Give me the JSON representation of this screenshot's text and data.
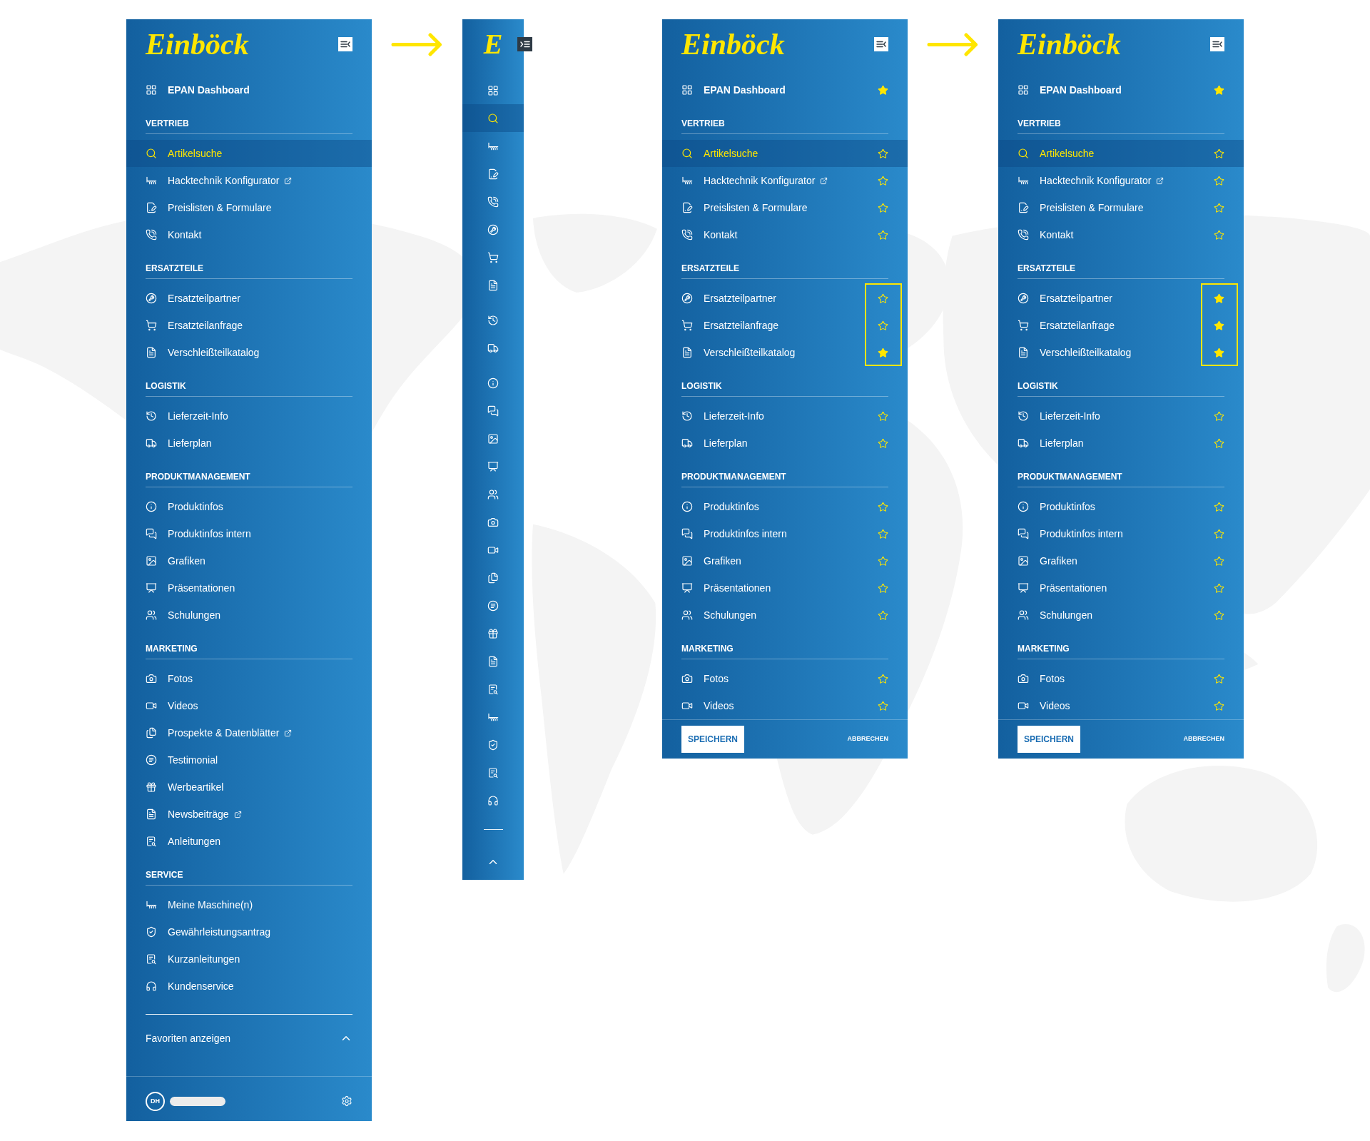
{
  "flows": [
    {
      "panels": [
        {
          "kind": "expanded",
          "logo": "Einböck",
          "sections": [
            {
              "items": [
                {
                  "label": "EPAN Dashboard",
                  "kind": "dashboard",
                  "selected": false,
                  "external": false
                }
              ]
            },
            {
              "title": "VERTRIEB",
              "items": [
                {
                  "label": "Artikelsuche",
                  "kind": "search",
                  "selected": true,
                  "external": false
                },
                {
                  "label": "Hacktechnik Konfigurator",
                  "kind": "rake",
                  "selected": false,
                  "external": true
                },
                {
                  "label": "Preislisten & Formulare",
                  "kind": "form",
                  "selected": false,
                  "external": false
                },
                {
                  "label": "Kontakt",
                  "kind": "phone",
                  "selected": false,
                  "external": false
                }
              ]
            },
            {
              "title": "ERSATZTEILE",
              "items": [
                {
                  "label": "Ersatzteilpartner",
                  "kind": "wrench",
                  "selected": false,
                  "external": false
                },
                {
                  "label": "Ersatzteilanfrage",
                  "kind": "cart",
                  "selected": false,
                  "external": false
                },
                {
                  "label": "Verschleißteilkatalog",
                  "kind": "catalog",
                  "selected": false,
                  "external": false
                }
              ]
            },
            {
              "title": "LOGISTIK",
              "items": [
                {
                  "label": "Lieferzeit-Info",
                  "kind": "clock",
                  "selected": false,
                  "external": false
                },
                {
                  "label": "Lieferplan",
                  "kind": "truck",
                  "selected": false,
                  "external": false
                }
              ]
            },
            {
              "title": "PRODUKTMANAGEMENT",
              "items": [
                {
                  "label": "Produktinfos",
                  "kind": "info",
                  "selected": false,
                  "external": false
                },
                {
                  "label": "Produktinfos intern",
                  "kind": "chat",
                  "selected": false,
                  "external": false
                },
                {
                  "label": "Grafiken",
                  "kind": "image",
                  "selected": false,
                  "external": false
                },
                {
                  "label": "Präsentationen",
                  "kind": "presentation",
                  "selected": false,
                  "external": false
                },
                {
                  "label": "Schulungen",
                  "kind": "training",
                  "selected": false,
                  "external": false
                }
              ]
            },
            {
              "title": "MARKETING",
              "items": [
                {
                  "label": "Fotos",
                  "kind": "camera",
                  "selected": false,
                  "external": false
                },
                {
                  "label": "Videos",
                  "kind": "video",
                  "selected": false,
                  "external": false
                },
                {
                  "label": "Prospekte & Datenblätter",
                  "kind": "brochure",
                  "selected": false,
                  "external": true
                },
                {
                  "label": "Testimonial",
                  "kind": "testimonial",
                  "selected": false,
                  "external": false
                },
                {
                  "label": "Werbeartikel",
                  "kind": "gift",
                  "selected": false,
                  "external": false
                },
                {
                  "label": "Newsbeiträge",
                  "kind": "news",
                  "selected": false,
                  "external": true
                },
                {
                  "label": "Anleitungen",
                  "kind": "manual",
                  "selected": false,
                  "external": false
                }
              ]
            },
            {
              "title": "SERVICE",
              "items": [
                {
                  "label": "Meine Maschine(n)",
                  "kind": "rake",
                  "selected": false,
                  "external": false
                },
                {
                  "label": "Gewährleistungsantrag",
                  "kind": "shield",
                  "selected": false,
                  "external": false
                },
                {
                  "label": "Kurzanleitungen",
                  "kind": "manual",
                  "selected": false,
                  "external": false
                },
                {
                  "label": "Kundenservice",
                  "kind": "headset",
                  "selected": false,
                  "external": false
                }
              ]
            }
          ],
          "favorites_toggle": {
            "label": "Favoriten anzeigen",
            "expanded": true
          },
          "user": {
            "initials": "DH"
          }
        },
        {
          "kind": "collapsed",
          "logo": "E",
          "groups": [
            {
              "items": [
                {
                  "kind": "dashboard",
                  "selected": false
                },
                {
                  "kind": "search",
                  "selected": true
                },
                {
                  "kind": "rake",
                  "selected": false
                },
                {
                  "kind": "form",
                  "selected": false
                },
                {
                  "kind": "phone",
                  "selected": false
                },
                {
                  "kind": "wrench",
                  "selected": false
                },
                {
                  "kind": "cart",
                  "selected": false
                },
                {
                  "kind": "catalog",
                  "selected": false
                }
              ]
            },
            {
              "items": [
                {
                  "kind": "clock",
                  "selected": false
                },
                {
                  "kind": "truck",
                  "selected": false
                }
              ]
            },
            {
              "items": [
                {
                  "kind": "info",
                  "selected": false
                },
                {
                  "kind": "chat",
                  "selected": false
                },
                {
                  "kind": "image",
                  "selected": false
                },
                {
                  "kind": "presentation",
                  "selected": false
                },
                {
                  "kind": "training",
                  "selected": false
                },
                {
                  "kind": "camera",
                  "selected": false
                },
                {
                  "kind": "video",
                  "selected": false
                },
                {
                  "kind": "brochure",
                  "selected": false
                },
                {
                  "kind": "testimonial",
                  "selected": false
                },
                {
                  "kind": "gift",
                  "selected": false
                },
                {
                  "kind": "news",
                  "selected": false
                },
                {
                  "kind": "manual",
                  "selected": false
                },
                {
                  "kind": "rake",
                  "selected": false
                },
                {
                  "kind": "shield",
                  "selected": false
                },
                {
                  "kind": "manual",
                  "selected": false
                },
                {
                  "kind": "headset",
                  "selected": false
                }
              ]
            }
          ],
          "favorites_toggle": {
            "expanded": true
          }
        }
      ]
    },
    {
      "panels": [
        {
          "kind": "editing",
          "logo": "Einböck",
          "sections": [
            {
              "outlined": false,
              "items": [
                {
                  "label": "EPAN Dashboard",
                  "kind": "dashboard",
                  "selected": false,
                  "external": false,
                  "favorite": true
                }
              ]
            },
            {
              "title": "VERTRIEB",
              "outlined": false,
              "items": [
                {
                  "label": "Artikelsuche",
                  "kind": "search",
                  "selected": true,
                  "external": false,
                  "favorite": false
                },
                {
                  "label": "Hacktechnik Konfigurator",
                  "kind": "rake",
                  "selected": false,
                  "external": true,
                  "favorite": false
                },
                {
                  "label": "Preislisten & Formulare",
                  "kind": "form",
                  "selected": false,
                  "external": false,
                  "favorite": false
                },
                {
                  "label": "Kontakt",
                  "kind": "phone",
                  "selected": false,
                  "external": false,
                  "favorite": false
                }
              ]
            },
            {
              "title": "ERSATZTEILE",
              "outlined": true,
              "items": [
                {
                  "label": "Ersatzteilpartner",
                  "kind": "wrench",
                  "selected": false,
                  "external": false,
                  "favorite": false
                },
                {
                  "label": "Ersatzteilanfrage",
                  "kind": "cart",
                  "selected": false,
                  "external": false,
                  "favorite": false
                },
                {
                  "label": "Verschleißteilkatalog",
                  "kind": "catalog",
                  "selected": false,
                  "external": false,
                  "favorite": true
                }
              ]
            },
            {
              "title": "LOGISTIK",
              "outlined": false,
              "items": [
                {
                  "label": "Lieferzeit-Info",
                  "kind": "clock",
                  "selected": false,
                  "external": false,
                  "favorite": false
                },
                {
                  "label": "Lieferplan",
                  "kind": "truck",
                  "selected": false,
                  "external": false,
                  "favorite": false
                }
              ]
            },
            {
              "title": "PRODUKTMANAGEMENT",
              "outlined": false,
              "items": [
                {
                  "label": "Produktinfos",
                  "kind": "info",
                  "selected": false,
                  "external": false,
                  "favorite": false
                },
                {
                  "label": "Produktinfos intern",
                  "kind": "chat",
                  "selected": false,
                  "external": false,
                  "favorite": false
                },
                {
                  "label": "Grafiken",
                  "kind": "image",
                  "selected": false,
                  "external": false,
                  "favorite": false
                },
                {
                  "label": "Präsentationen",
                  "kind": "presentation",
                  "selected": false,
                  "external": false,
                  "favorite": false
                },
                {
                  "label": "Schulungen",
                  "kind": "training",
                  "selected": false,
                  "external": false,
                  "favorite": false
                }
              ]
            },
            {
              "title": "MARKETING",
              "outlined": false,
              "items": [
                {
                  "label": "Fotos",
                  "kind": "camera",
                  "selected": false,
                  "external": false,
                  "favorite": false
                },
                {
                  "label": "Videos",
                  "kind": "video",
                  "selected": false,
                  "external": false,
                  "favorite": false
                }
              ]
            }
          ],
          "buttons": [
            {
              "label": "SPEICHERN",
              "kind": "save"
            },
            {
              "label": "ABBRECHEN",
              "kind": "cancel"
            }
          ]
        },
        {
          "kind": "editing",
          "logo": "Einböck",
          "sections": [
            {
              "outlined": false,
              "items": [
                {
                  "label": "EPAN Dashboard",
                  "kind": "dashboard",
                  "selected": false,
                  "external": false,
                  "favorite": true
                }
              ]
            },
            {
              "title": "VERTRIEB",
              "outlined": false,
              "items": [
                {
                  "label": "Artikelsuche",
                  "kind": "search",
                  "selected": true,
                  "external": false,
                  "favorite": false
                },
                {
                  "label": "Hacktechnik Konfigurator",
                  "kind": "rake",
                  "selected": false,
                  "external": true,
                  "favorite": false
                },
                {
                  "label": "Preislisten & Formulare",
                  "kind": "form",
                  "selected": false,
                  "external": false,
                  "favorite": false
                },
                {
                  "label": "Kontakt",
                  "kind": "phone",
                  "selected": false,
                  "external": false,
                  "favorite": false
                }
              ]
            },
            {
              "title": "ERSATZTEILE",
              "outlined": true,
              "items": [
                {
                  "label": "Ersatzteilpartner",
                  "kind": "wrench",
                  "selected": false,
                  "external": false,
                  "favorite": true
                },
                {
                  "label": "Ersatzteilanfrage",
                  "kind": "cart",
                  "selected": false,
                  "external": false,
                  "favorite": true
                },
                {
                  "label": "Verschleißteilkatalog",
                  "kind": "catalog",
                  "selected": false,
                  "external": false,
                  "favorite": true
                }
              ]
            },
            {
              "title": "LOGISTIK",
              "outlined": false,
              "items": [
                {
                  "label": "Lieferzeit-Info",
                  "kind": "clock",
                  "selected": false,
                  "external": false,
                  "favorite": false
                },
                {
                  "label": "Lieferplan",
                  "kind": "truck",
                  "selected": false,
                  "external": false,
                  "favorite": false
                }
              ]
            },
            {
              "title": "PRODUKTMANAGEMENT",
              "outlined": false,
              "items": [
                {
                  "label": "Produktinfos",
                  "kind": "info",
                  "selected": false,
                  "external": false,
                  "favorite": false
                },
                {
                  "label": "Produktinfos intern",
                  "kind": "chat",
                  "selected": false,
                  "external": false,
                  "favorite": false
                },
                {
                  "label": "Grafiken",
                  "kind": "image",
                  "selected": false,
                  "external": false,
                  "favorite": false
                },
                {
                  "label": "Präsentationen",
                  "kind": "presentation",
                  "selected": false,
                  "external": false,
                  "favorite": false
                },
                {
                  "label": "Schulungen",
                  "kind": "training",
                  "selected": false,
                  "external": false,
                  "favorite": false
                }
              ]
            },
            {
              "title": "MARKETING",
              "outlined": false,
              "items": [
                {
                  "label": "Fotos",
                  "kind": "camera",
                  "selected": false,
                  "external": false,
                  "favorite": false
                },
                {
                  "label": "Videos",
                  "kind": "video",
                  "selected": false,
                  "external": false,
                  "favorite": false
                }
              ]
            }
          ],
          "buttons": [
            {
              "label": "SPEICHERN",
              "kind": "save"
            },
            {
              "label": "ABBRECHEN",
              "kind": "cancel"
            }
          ]
        }
      ]
    }
  ]
}
